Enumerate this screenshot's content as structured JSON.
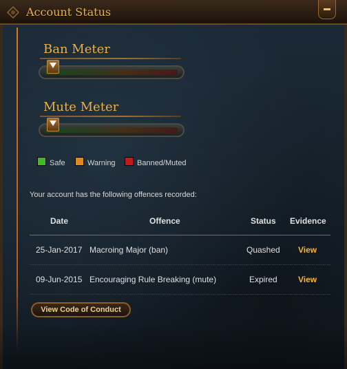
{
  "header": {
    "title": "Account Status",
    "minimize_icon": "minus-icon"
  },
  "ban_meter": {
    "title": "Ban Meter",
    "level": 0.02
  },
  "mute_meter": {
    "title": "Mute Meter",
    "level": 0.02
  },
  "legend": [
    {
      "label": "Safe",
      "color": "#3cbf1e"
    },
    {
      "label": "Warning",
      "color": "#e08a1e"
    },
    {
      "label": "Banned/Muted",
      "color": "#c21a1a"
    }
  ],
  "offences": {
    "intro": "Your account has the following offences recorded:",
    "headers": {
      "date": "Date",
      "offence": "Offence",
      "status": "Status",
      "evidence": "Evidence"
    },
    "rows": [
      {
        "date": "25-Jan-2017",
        "offence": "Macroing Major (ban)",
        "status": "Quashed",
        "evidence": "View"
      },
      {
        "date": "09-Jun-2015",
        "offence": "Encouraging Rule Breaking (mute)",
        "status": "Expired",
        "evidence": "View"
      }
    ]
  },
  "code_of_conduct_button": "View Code of Conduct",
  "colors": {
    "accent": "#e8b04a",
    "link": "#f2b63a",
    "panel": "#17222c"
  }
}
